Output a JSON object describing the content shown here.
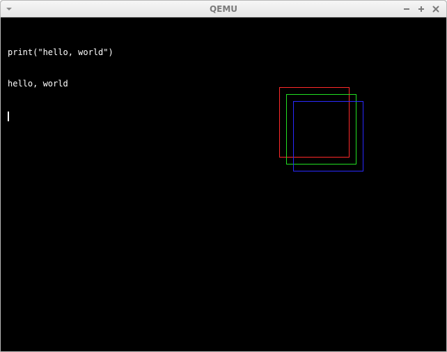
{
  "window": {
    "title": "QEMU",
    "buttons": [
      "menu",
      "minimize",
      "maximize",
      "close"
    ]
  },
  "console": {
    "lines": [
      "print(\"hello, world\")",
      "hello, world"
    ]
  },
  "graphics": {
    "squares": [
      {
        "name": "red-square",
        "color": "#ff2a2a"
      },
      {
        "name": "green-square",
        "color": "#22e022"
      },
      {
        "name": "blue-square",
        "color": "#2a2aff"
      }
    ]
  }
}
